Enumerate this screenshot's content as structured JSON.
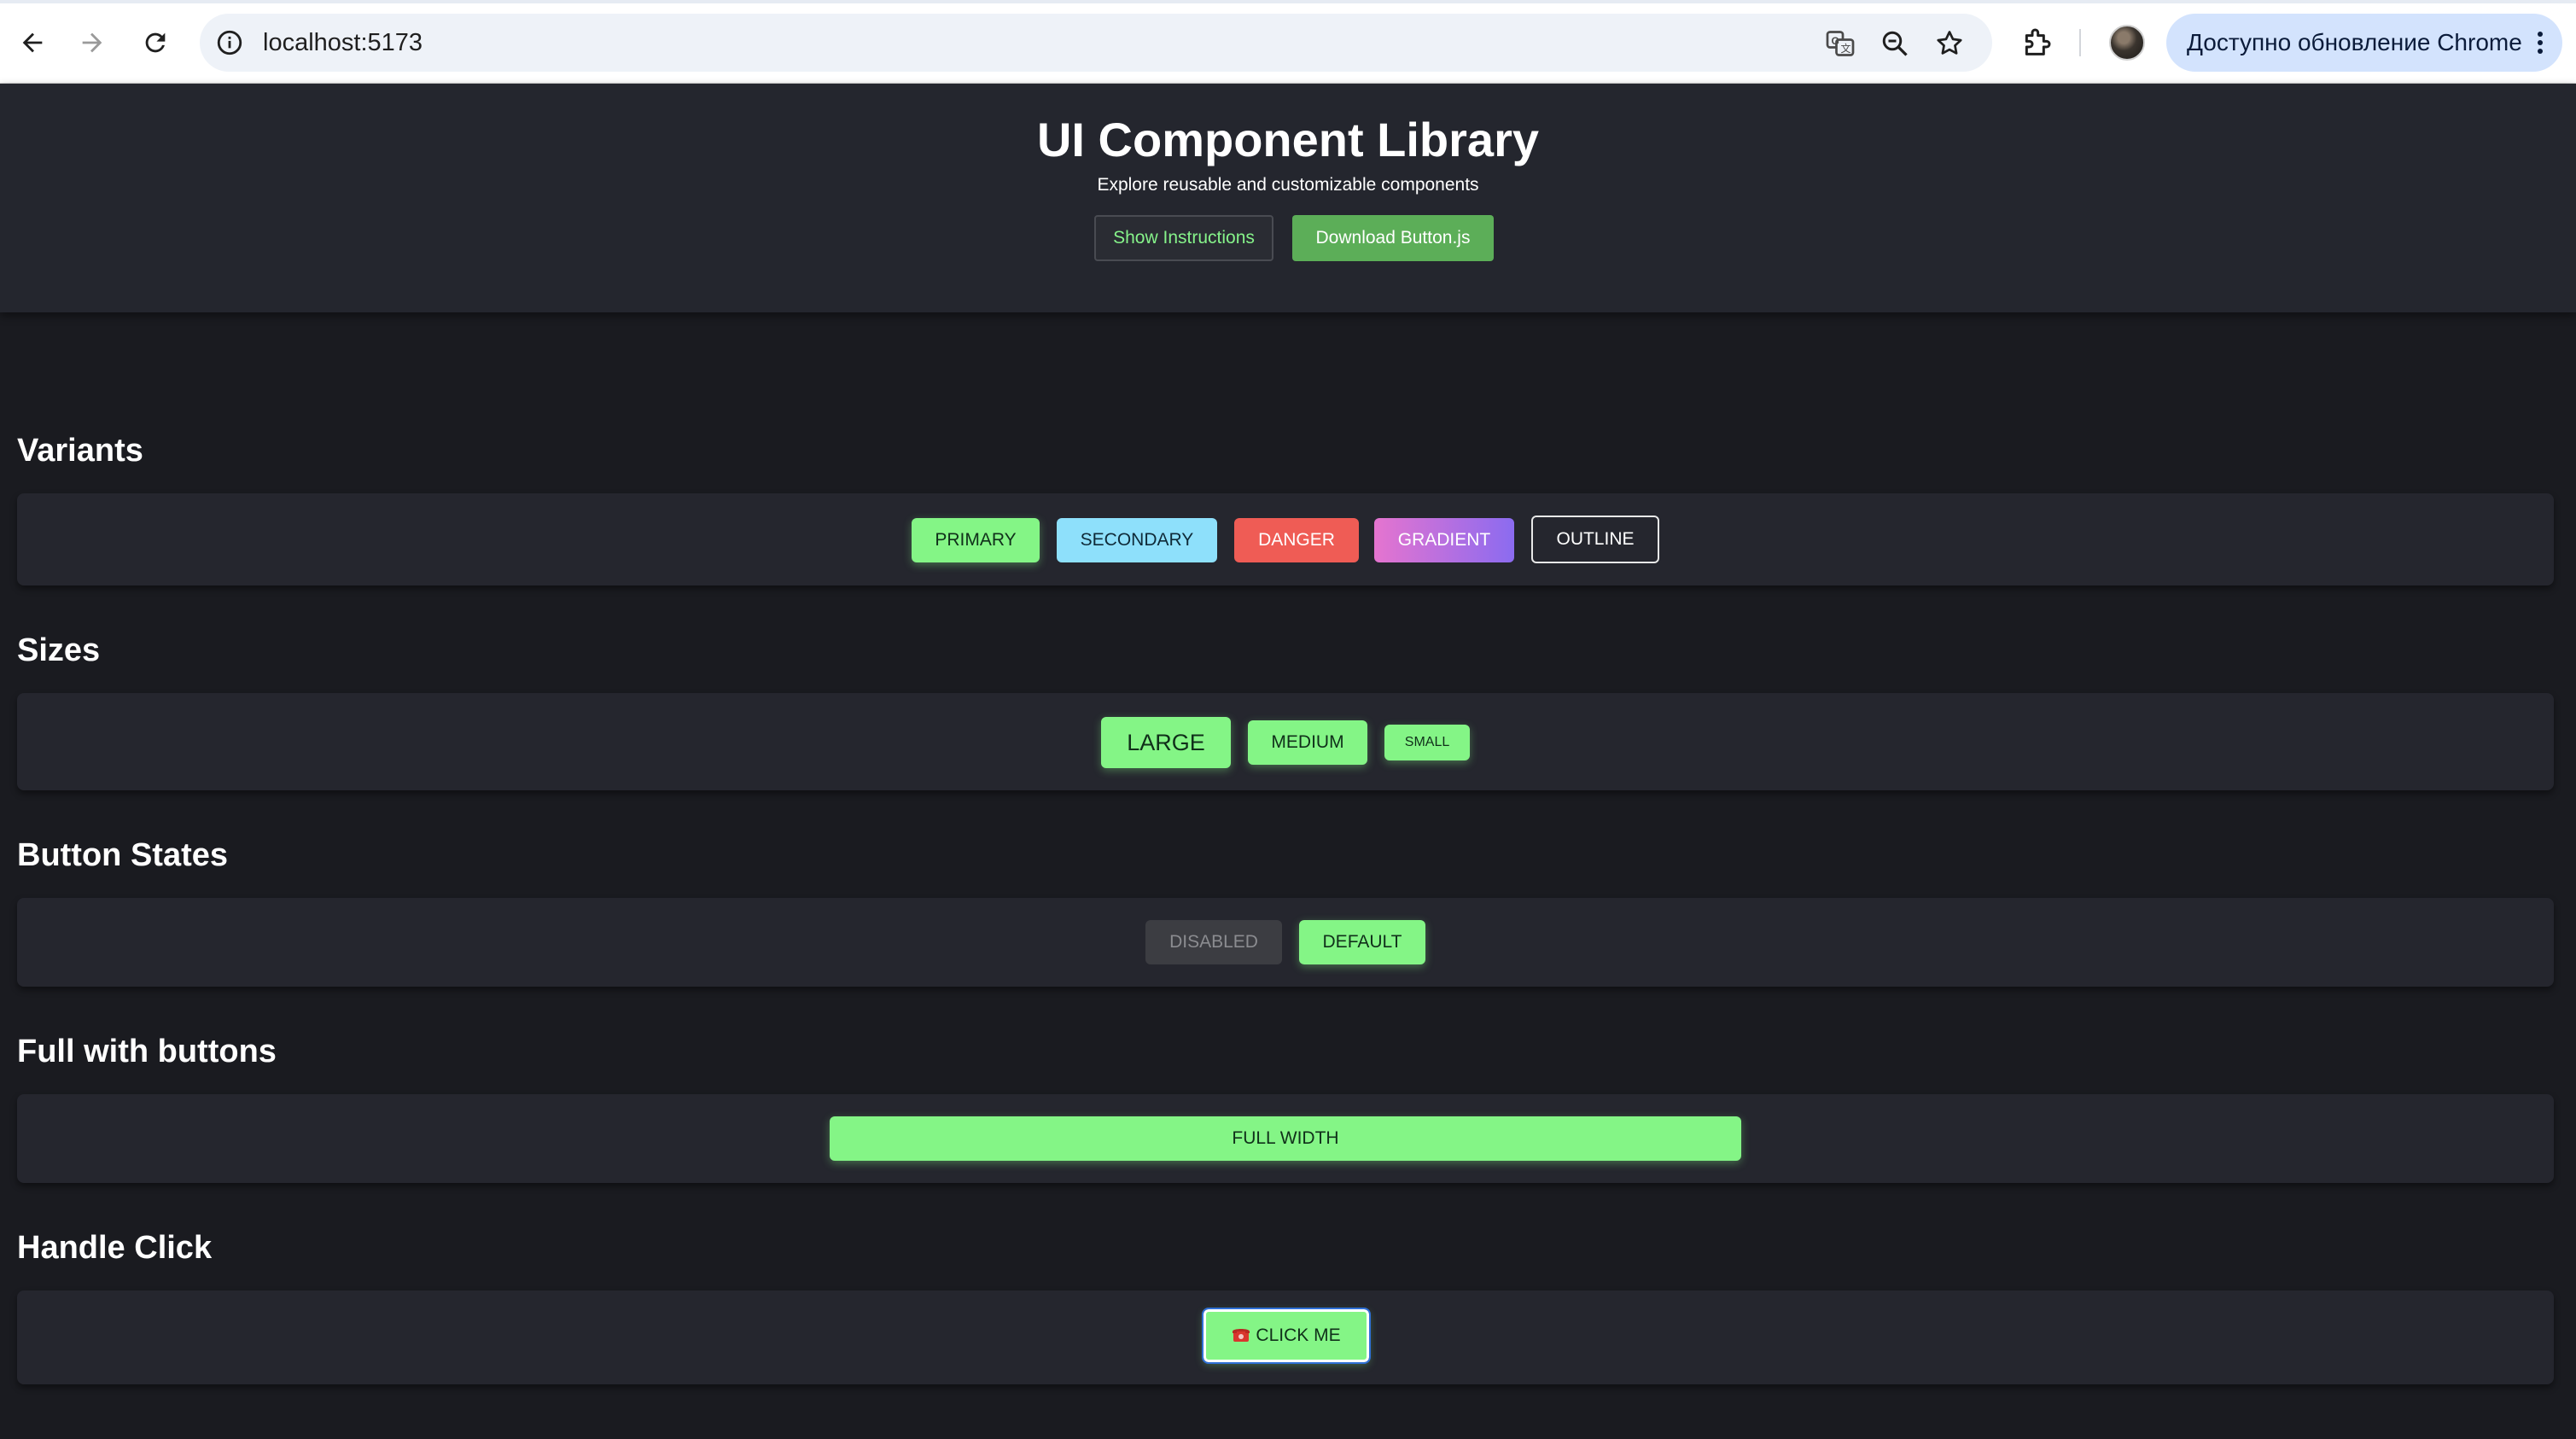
{
  "browser": {
    "url": "localhost:5173",
    "update_label": "Доступно обновление Chrome"
  },
  "header": {
    "title": "UI Component Library",
    "subtitle": "Explore reusable and customizable components",
    "instructions_label": "Show Instructions",
    "download_label": "Download Button.js"
  },
  "sections": {
    "variants": {
      "title": "Variants",
      "buttons": {
        "primary": "PRIMARY",
        "secondary": "SECONDARY",
        "danger": "DANGER",
        "gradient": "GRADIENT",
        "outline": "OUTLINE"
      }
    },
    "sizes": {
      "title": "Sizes",
      "buttons": {
        "large": "LARGE",
        "medium": "MEDIUM",
        "small": "SMALL"
      }
    },
    "states": {
      "title": "Button States",
      "buttons": {
        "disabled": "DISABLED",
        "default": "DEFAULT"
      }
    },
    "full_width": {
      "title": "Full with buttons",
      "button": "FULL WIDTH"
    },
    "handle_click": {
      "title": "Handle Click",
      "button": "CLICK ME",
      "button_icon": "telephone-icon"
    }
  },
  "colors": {
    "primary": "#84f586",
    "secondary": "#8ee0fb",
    "danger": "#ef5c55",
    "gradient_start": "#e574cf",
    "gradient_end": "#8b6bf0",
    "disabled": "#3c3d42",
    "panel": "#25262e",
    "background": "#1a1b20",
    "download": "#5cae58"
  }
}
